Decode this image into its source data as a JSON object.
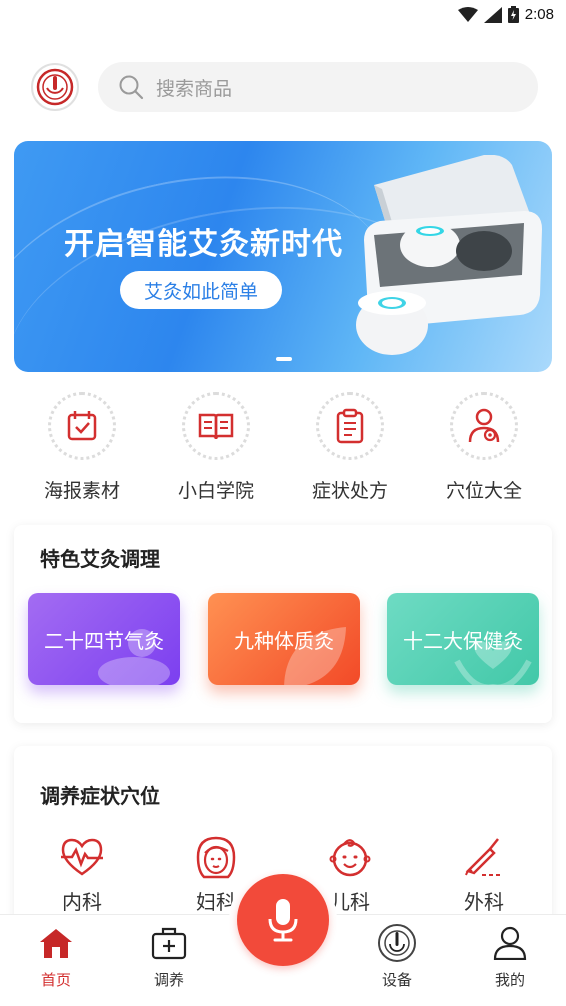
{
  "status_bar": {
    "time": "2:08"
  },
  "header": {
    "search_placeholder": "搜索商品"
  },
  "banner": {
    "title": "开启智能艾灸新时代",
    "pill_label": "艾灸如此简单"
  },
  "quick_nav": [
    {
      "label": "海报素材",
      "icon": "calendar-check-icon"
    },
    {
      "label": "小白学院",
      "icon": "open-book-icon"
    },
    {
      "label": "症状处方",
      "icon": "clipboard-icon"
    },
    {
      "label": "穴位大全",
      "icon": "person-pin-icon"
    }
  ],
  "featured": {
    "title": "特色艾灸调理",
    "tiles": [
      {
        "label": "二十四节气灸",
        "color": "#8b4ff0"
      },
      {
        "label": "九种体质灸",
        "color": "#f4582e"
      },
      {
        "label": "十二大保健灸",
        "color": "#4cceb0"
      }
    ]
  },
  "symptoms": {
    "title": "调养症状穴位",
    "items": [
      {
        "label": "内科",
        "icon": "heartbeat-icon"
      },
      {
        "label": "妇科",
        "icon": "woman-face-icon"
      },
      {
        "label": "儿科",
        "icon": "child-face-icon"
      },
      {
        "label": "外科",
        "icon": "scalpel-icon"
      }
    ]
  },
  "bottom_nav": [
    {
      "label": "首页",
      "icon": "home-icon",
      "active": true
    },
    {
      "label": "调养",
      "icon": "medical-kit-icon",
      "active": false
    },
    {
      "label": "设备",
      "icon": "power-device-icon",
      "active": false
    },
    {
      "label": "我的",
      "icon": "user-icon",
      "active": false
    }
  ],
  "colors": {
    "brand_red": "#d32f2f",
    "mic_red": "#f24a3a",
    "banner_blue": "#2d86ee"
  }
}
